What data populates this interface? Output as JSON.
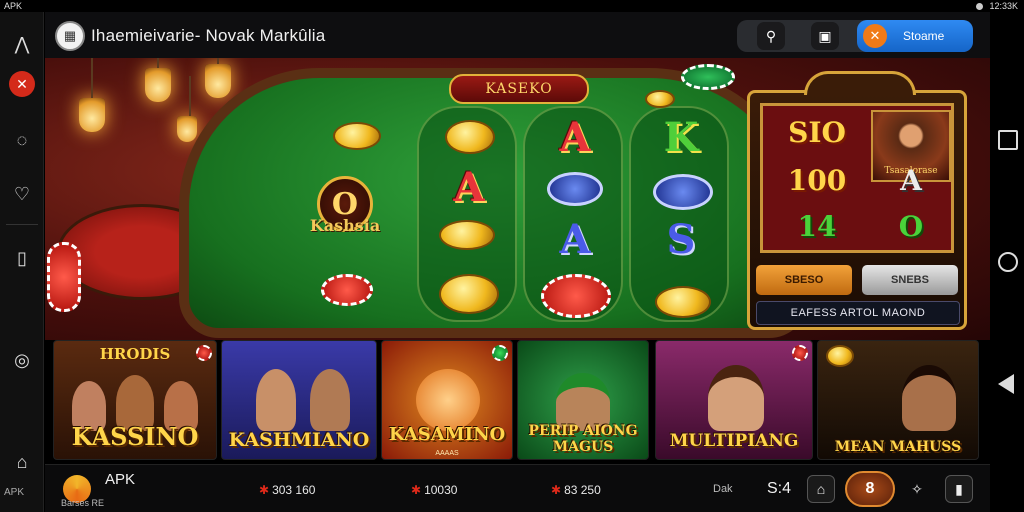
{
  "status_bar": {
    "left_text": "APK",
    "time": "12:33K"
  },
  "left_rail": {
    "bottom_label": "APK"
  },
  "header": {
    "app_title": "Ihaemieivarie- Novak Markûlia",
    "primary_button_label": "Stoame"
  },
  "hero": {
    "table_title": "KASEKO",
    "logo_glyph": "O",
    "logo_word": "Kashsia",
    "reels": [
      [
        "A",
        "A"
      ],
      [
        "A",
        "A"
      ],
      [
        "K",
        "S"
      ]
    ]
  },
  "slot_machine": {
    "cells": [
      "SIO",
      "100",
      "A",
      "14",
      "O"
    ],
    "portrait_caption": "Tsasalorase",
    "spin_label": "SBESO",
    "bet_label": "SNEBS",
    "footer_text": "EAFESS ARTOL MAOND"
  },
  "game_cards": [
    {
      "top_title": "HRODIS",
      "title": "KASSINO",
      "subtitle": ""
    },
    {
      "top_title": "",
      "title": "KASHMIANO",
      "subtitle": ""
    },
    {
      "top_title": "",
      "title": "KASAMINO",
      "subtitle": "AAAAS"
    },
    {
      "top_title": "",
      "title": "PERIP AIONG MAGUS",
      "subtitle": ""
    },
    {
      "top_title": "",
      "title": "MULTIPIANG",
      "subtitle": ""
    },
    {
      "top_title": "",
      "title": "MEAN MAHUSS",
      "subtitle": ""
    }
  ],
  "bottom_bar": {
    "brand": "APK",
    "brand_sub": "Barses RE",
    "stats": [
      "303 160",
      "10030",
      "83 250"
    ],
    "user": "Dak",
    "time": "S:4",
    "main_badge": "8"
  },
  "colors": {
    "felt": "#2fa03a",
    "gold": "#ffd54a",
    "accent_blue": "#2f8af2",
    "accent_orange": "#f07a18"
  },
  "icons": [
    "search-icon",
    "grid-icon",
    "gift-icon",
    "share-icon",
    "profile-icon"
  ]
}
